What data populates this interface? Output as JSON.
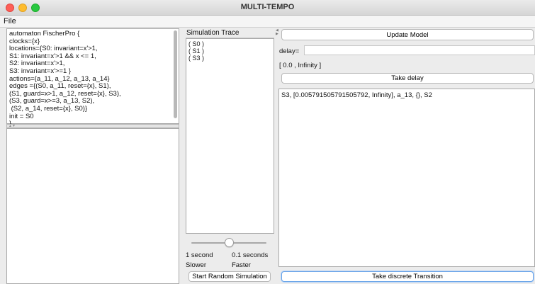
{
  "window": {
    "title": "MULTI-TEMPO"
  },
  "menu": {
    "file": "File"
  },
  "model_text": [
    "automaton FischerPro {",
    "clocks={x}",
    "locations={S0: invariant=x'>1,",
    "S1: invariant=x'>1 && x <= 1,",
    "S2: invariant=x'>1,",
    "S3: invariant=x'>=1 }",
    "actions={a_11, a_12, a_13, a_14}",
    "edges ={(S0, a_11, reset={x}, S1),",
    "(S1, guard=x>1, a_12, reset={x}, S3),",
    "(S3, guard=x>=3, a_13, S2),",
    " (S2, a_14, reset={x}, S0)}",
    "init = S0",
    "}"
  ],
  "trace": {
    "header": "Simulation Trace",
    "items": [
      "( S0 )",
      "( S1 )",
      "( S3 )"
    ]
  },
  "speed": {
    "left_value": "1 second",
    "right_value": "0.1 seconds",
    "left_caption": "Slower",
    "right_caption": "Faster",
    "level": 0.5
  },
  "buttons": {
    "start_random": "Start Random Simulation",
    "update_model": "Update Model",
    "take_delay": "Take delay",
    "take_discrete": "Take discrete Transition"
  },
  "delay": {
    "label": "delay=",
    "value": "",
    "interval": "[  0.0  ,   Infinity  ]"
  },
  "transitions": [
    "S3, [0.005791505791505792, Infinity], a_13, {}, S2"
  ]
}
